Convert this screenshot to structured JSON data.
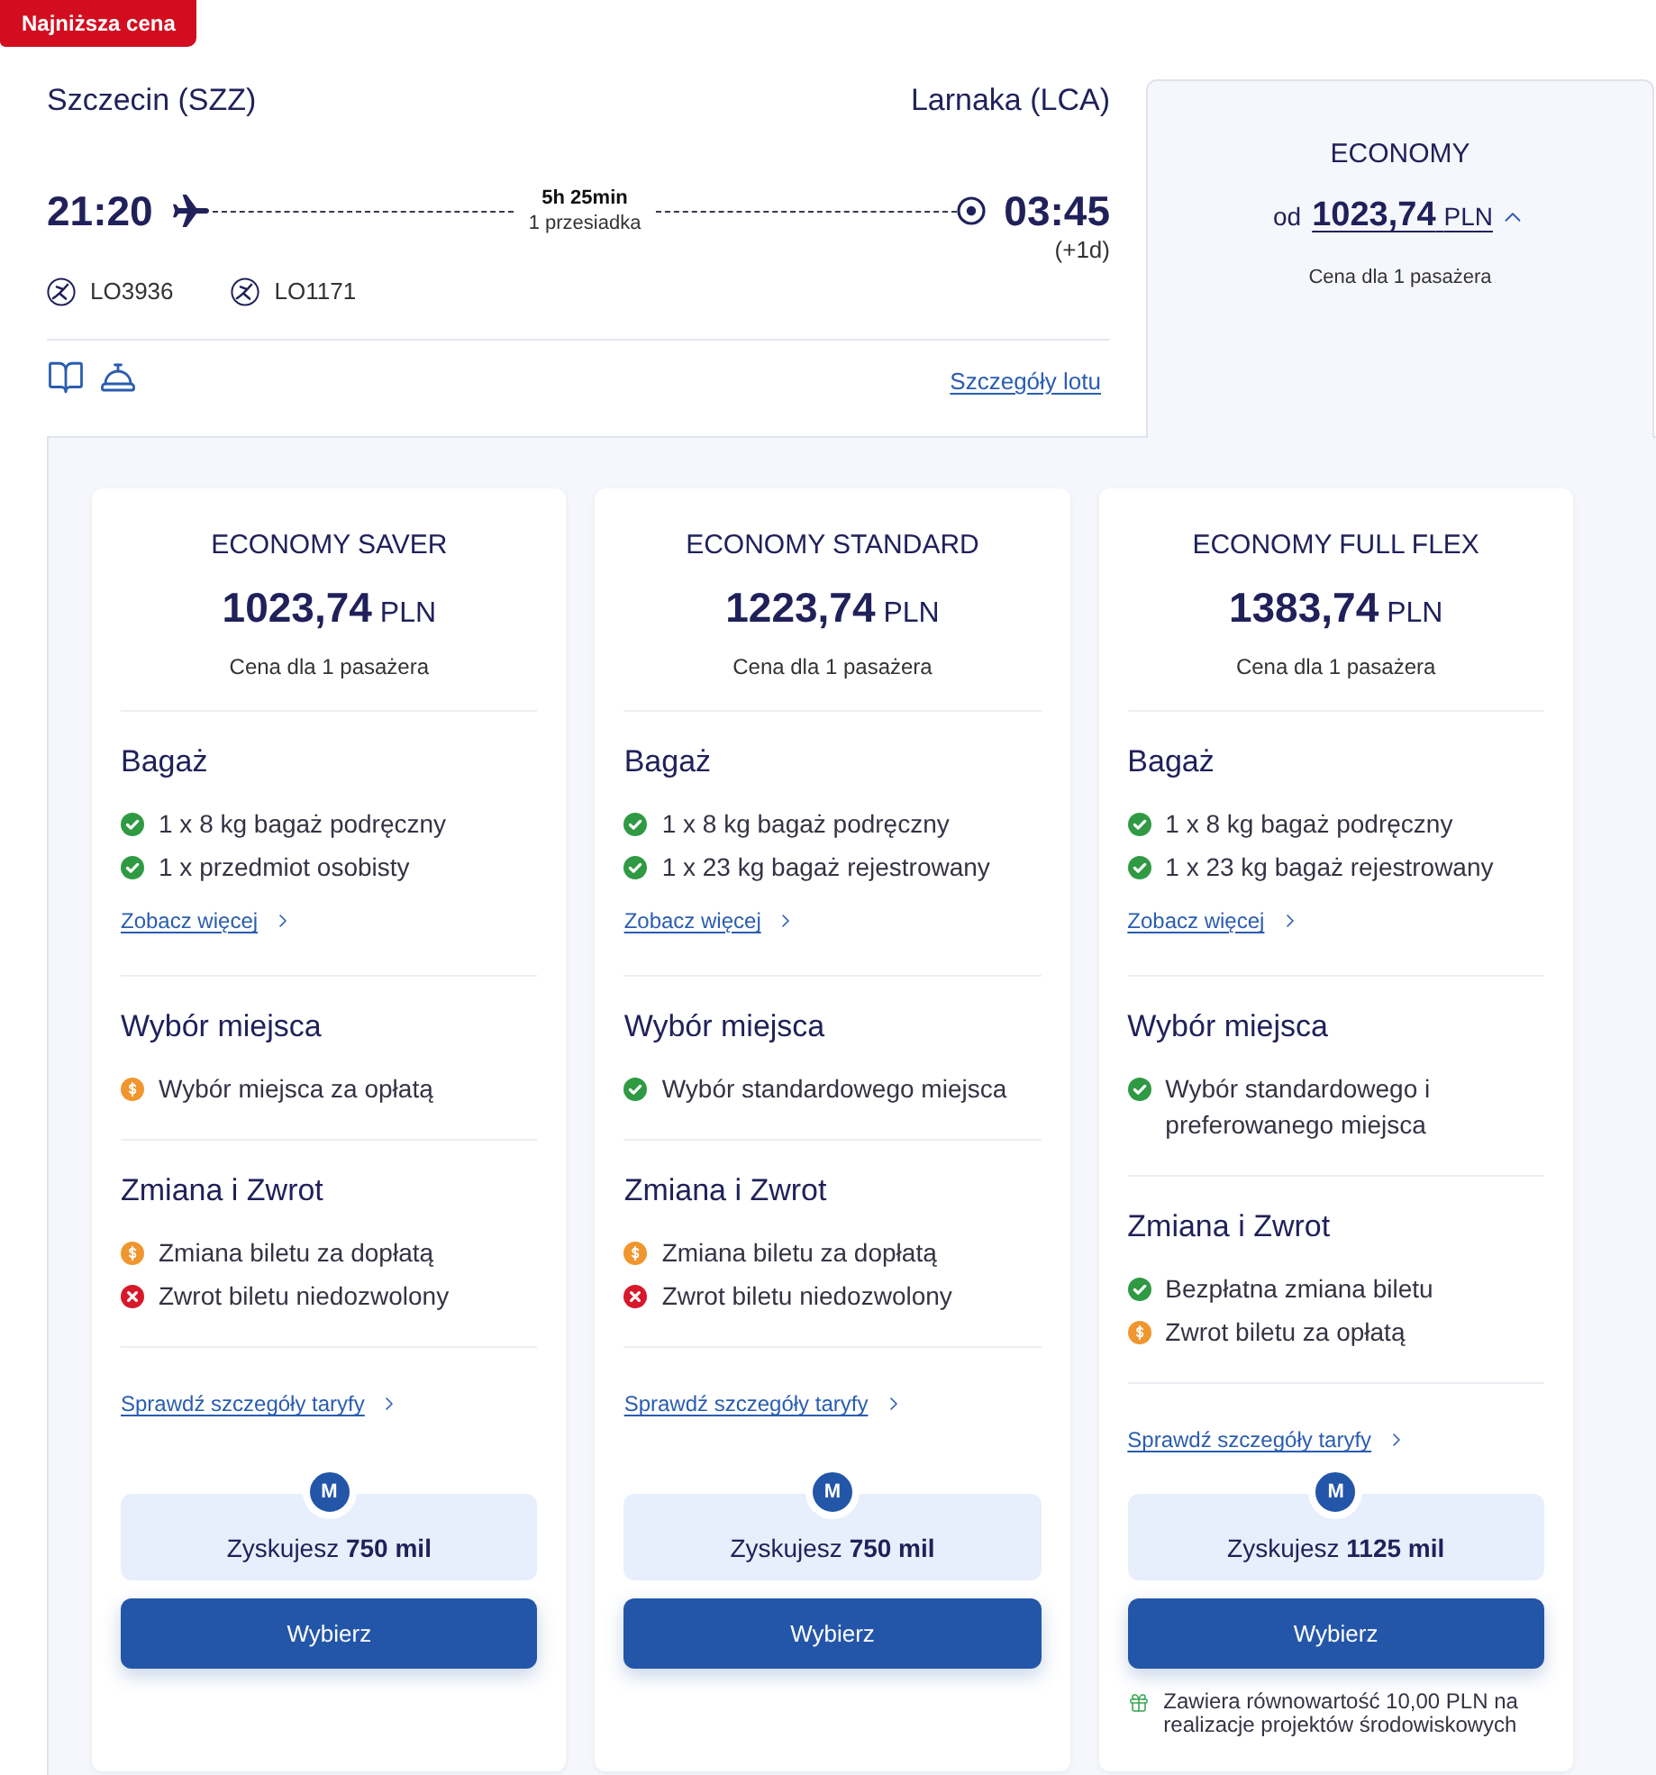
{
  "badge": {
    "label": "Najniższa cena"
  },
  "flight": {
    "origin": "Szczecin (SZZ)",
    "destination": "Larnaka (LCA)",
    "departure": "21:20",
    "arrival": "03:45",
    "arrival_day_offset": "(+1d)",
    "duration": "5h 25min",
    "stops": "1 przesiadka",
    "segments": [
      {
        "flight_number": "LO3936"
      },
      {
        "flight_number": "LO1171"
      }
    ],
    "details_link": "Szczegóły lotu"
  },
  "cabin": {
    "name": "ECONOMY",
    "price_prefix": "od",
    "price": "1023,74",
    "currency": "PLN",
    "price_note": "Cena dla 1 pasażera",
    "expanded": true
  },
  "fares": [
    {
      "name": "ECONOMY SAVER",
      "price": "1023,74",
      "currency": "PLN",
      "price_note": "Cena dla 1 pasażera",
      "sections": [
        {
          "title": "Bagaż",
          "items": [
            {
              "kind": "included",
              "text": "1 x 8 kg bagaż podręczny"
            },
            {
              "kind": "included",
              "text": "1 x przedmiot osobisty"
            }
          ],
          "link": "Zobacz więcej"
        },
        {
          "title": "Wybór miejsca",
          "items": [
            {
              "kind": "paid",
              "text": "Wybór miejsca za opłatą"
            }
          ]
        },
        {
          "title": "Zmiana i Zwrot",
          "items": [
            {
              "kind": "paid",
              "text": "Zmiana biletu za dopłatą"
            },
            {
              "kind": "excluded",
              "text": "Zwrot biletu niedozwolony"
            }
          ]
        }
      ],
      "details_link": "Sprawdź szczegóły taryfy",
      "miles_badge": "M",
      "miles": "Zyskujesz **750 mil**",
      "button": "Wybierz"
    },
    {
      "name": "ECONOMY STANDARD",
      "price": "1223,74",
      "currency": "PLN",
      "price_note": "Cena dla 1 pasażera",
      "sections": [
        {
          "title": "Bagaż",
          "items": [
            {
              "kind": "included",
              "text": "1 x 8 kg bagaż podręczny"
            },
            {
              "kind": "included",
              "text": "1 x 23 kg bagaż rejestrowany"
            }
          ],
          "link": "Zobacz więcej"
        },
        {
          "title": "Wybór miejsca",
          "items": [
            {
              "kind": "included",
              "text": "Wybór standardowego miejsca"
            }
          ]
        },
        {
          "title": "Zmiana i Zwrot",
          "items": [
            {
              "kind": "paid",
              "text": "Zmiana biletu za dopłatą"
            },
            {
              "kind": "excluded",
              "text": "Zwrot biletu niedozwolony"
            }
          ]
        }
      ],
      "details_link": "Sprawdź szczegóły taryfy",
      "miles_badge": "M",
      "miles": "Zyskujesz **750 mil**",
      "button": "Wybierz"
    },
    {
      "name": "ECONOMY FULL FLEX",
      "price": "1383,74",
      "currency": "PLN",
      "price_note": "Cena dla 1 pasażera",
      "sections": [
        {
          "title": "Bagaż",
          "items": [
            {
              "kind": "included",
              "text": "1 x 8 kg bagaż podręczny"
            },
            {
              "kind": "included",
              "text": "1 x 23 kg bagaż rejestrowany"
            }
          ],
          "link": "Zobacz więcej"
        },
        {
          "title": "Wybór miejsca",
          "items": [
            {
              "kind": "included",
              "text": "Wybór standardowego i preferowanego miejsca"
            }
          ]
        },
        {
          "title": "Zmiana i Zwrot",
          "items": [
            {
              "kind": "included",
              "text": "Bezpłatna zmiana biletu"
            },
            {
              "kind": "paid",
              "text": "Zwrot biletu za opłatą"
            }
          ]
        }
      ],
      "details_link": "Sprawdź szczegóły taryfy",
      "miles_badge": "M",
      "miles": "Zyskujesz **1125 mil**",
      "button": "Wybierz",
      "footnote": "Zawiera równowartość 10,00 PLN na realizacje projektów środowiskowych"
    }
  ]
}
